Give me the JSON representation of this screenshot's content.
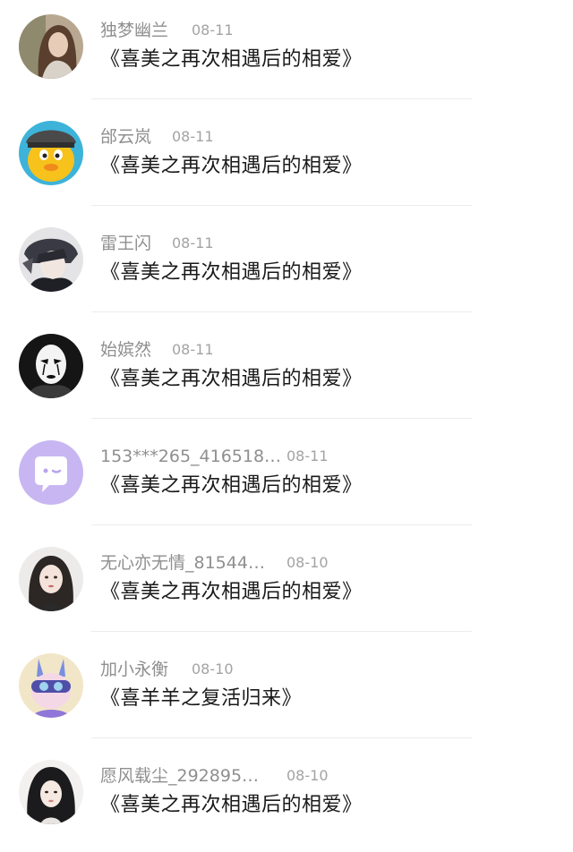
{
  "comments": [
    {
      "username": "独梦幽兰",
      "date": "08-11",
      "message": "《喜美之再次相遇后的相爱》",
      "avatar": "avatar-girl-long-hair"
    },
    {
      "username": "邰云岚",
      "date": "08-11",
      "message": "《喜美之再次相遇后的相爱》",
      "avatar": "avatar-yellow-chick"
    },
    {
      "username": "雷王闪",
      "date": "08-11",
      "message": "《喜美之再次相遇后的相爱》",
      "avatar": "avatar-anime-boy"
    },
    {
      "username": "始嫔然",
      "date": "08-11",
      "message": "《喜美之再次相遇后的相爱》",
      "avatar": "avatar-mime-mask"
    },
    {
      "username": "153***265_416518…",
      "date": "08-11",
      "message": "《喜美之再次相遇后的相爱》",
      "avatar": "avatar-chat-bubble"
    },
    {
      "username": "无心亦无情_81544…",
      "date": "08-10",
      "message": "《喜美之再次相遇后的相爱》",
      "avatar": "avatar-girl-dark-hair"
    },
    {
      "username": "加小永衡",
      "date": "08-10",
      "message": "《喜羊羊之复活归来》",
      "avatar": "avatar-cartoon-rabbit"
    },
    {
      "username": "愿风载尘_292895…",
      "date": "08-10",
      "message": "《喜美之再次相遇后的相爱》",
      "avatar": "avatar-girl-black-hair"
    }
  ]
}
